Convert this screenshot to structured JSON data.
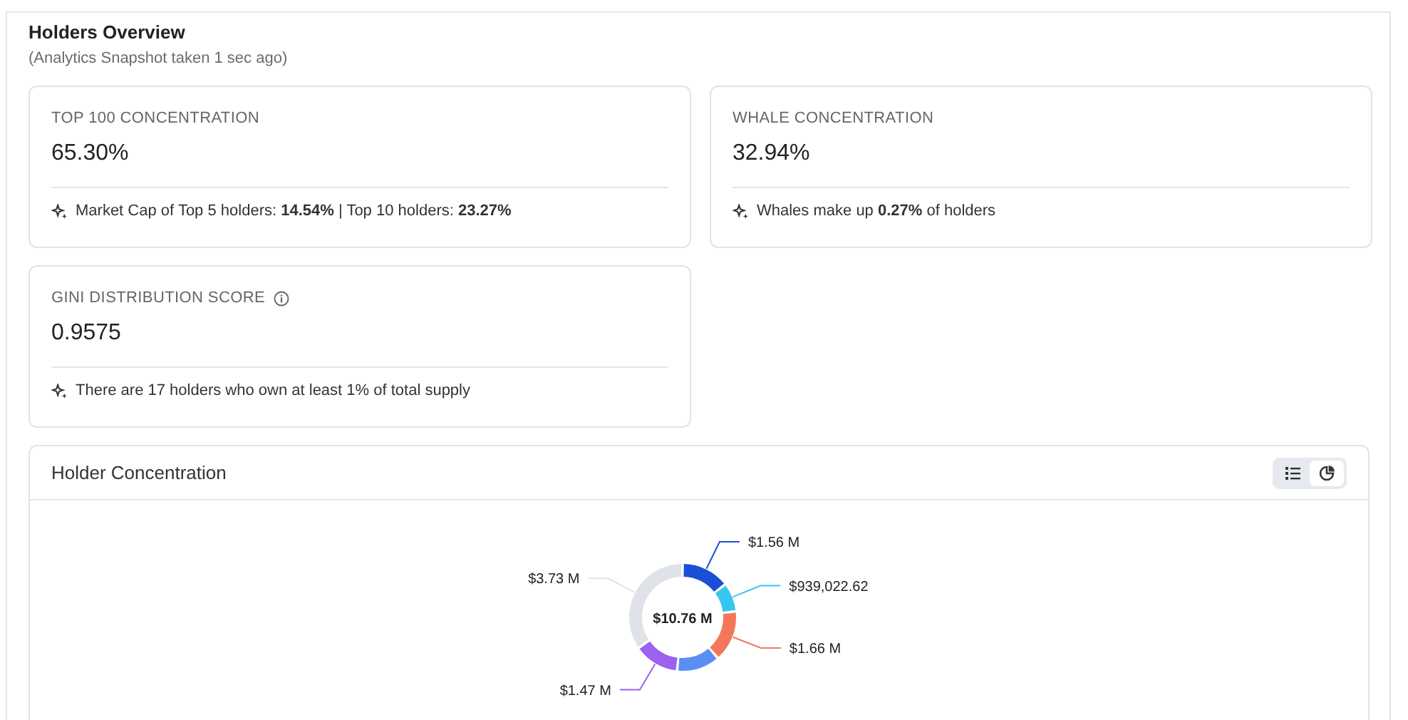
{
  "header": {
    "title": "Holders Overview",
    "subtitle": "(Analytics Snapshot taken 1 sec ago)"
  },
  "cards": [
    {
      "label": "TOP 100 CONCENTRATION",
      "info": false,
      "value": "65.30%",
      "note": "Market Cap of Top 5 holders: **14.54%** | Top 10 holders: **23.27%**"
    },
    {
      "label": "WHALE CONCENTRATION",
      "info": false,
      "value": "32.94%",
      "note": "Whales make up **0.27%** of holders"
    },
    {
      "label": "GINI DISTRIBUTION SCORE",
      "info": true,
      "value": "0.9575",
      "note": "There are 17 holders who own at least 1% of total supply"
    }
  ],
  "chart_panel": {
    "title": "Holder Concentration",
    "view_toggle": [
      {
        "kind": "list",
        "selected": false
      },
      {
        "kind": "pie",
        "selected": true
      }
    ],
    "center_label": "$10.76 M",
    "chart_data": {
      "type": "donut",
      "values": [
        1560000,
        939022.62,
        1660000,
        1400000,
        1470000,
        3730000
      ],
      "colors": [
        "#1a4fd6",
        "#38c6f0",
        "#f5775a",
        "#5b8ef5",
        "#9a62ee",
        "#dfe3e8"
      ],
      "value_labels": [
        "$1.56 M",
        "$939,022.62",
        "$1.66 M",
        null,
        "$1.47 M",
        "$3.73 M"
      ]
    }
  }
}
